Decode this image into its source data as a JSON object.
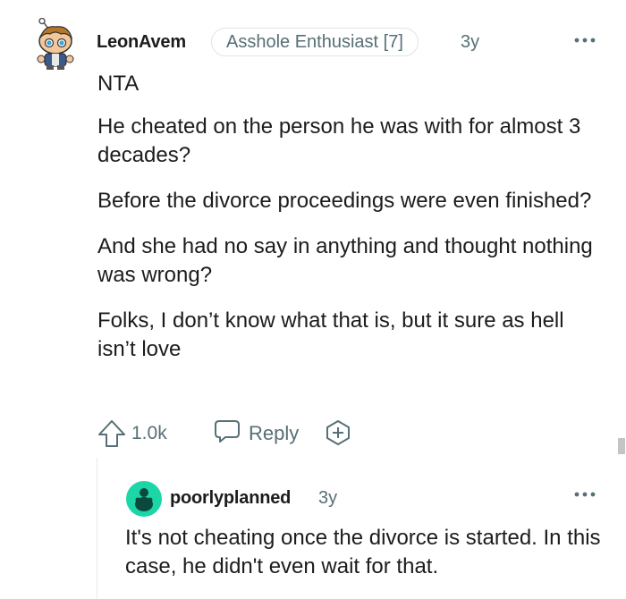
{
  "comment": {
    "username": "LeonAvem",
    "flair": "Asshole Enthusiast [7]",
    "time": "3y",
    "paragraphs": [
      "NTA",
      "He cheated on the person he was with for almost 3 decades?",
      "Before the divorce proceedings were even finished?",
      "And she had no say in anything and thought nothing was wrong?",
      "Folks, I don’t know what that is, but it sure as hell isn’t love"
    ],
    "actions": {
      "upvote_count": "1.0k",
      "reply_label": "Reply"
    },
    "icons": {
      "avatar": "snoo-avatar-icon",
      "more": "more-options-icon",
      "upvote": "upvote-arrow-icon",
      "reply": "chat-bubble-icon",
      "award": "award-plus-icon"
    }
  },
  "reply": {
    "username": "poorlyplanned",
    "time": "3y",
    "paragraphs": [
      "It's not cheating once the divorce is started. In this case, he didn't even wait for that."
    ],
    "icons": {
      "avatar": "default-snoo-avatar-icon",
      "more": "more-options-icon"
    }
  },
  "colors": {
    "text": "#1c1c1c",
    "meta": "#576f76",
    "avatar_teal": "#1dd6a8",
    "border": "#e1e3e6"
  }
}
